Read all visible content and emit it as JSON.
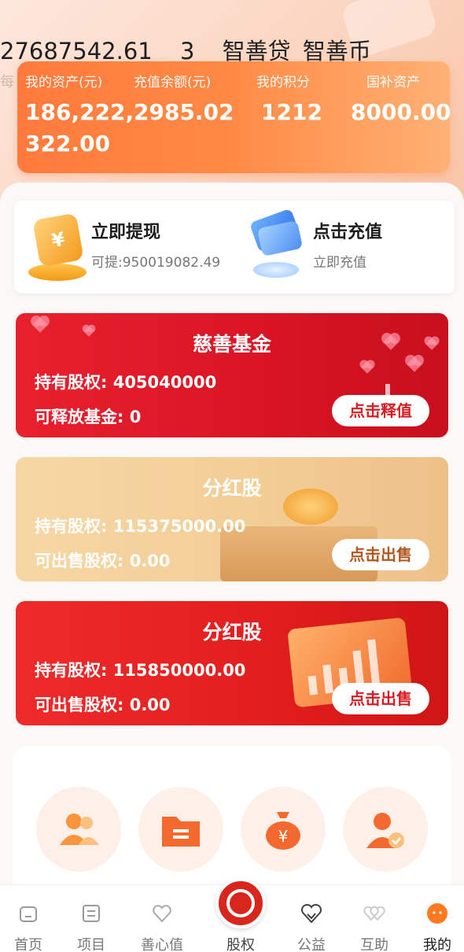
{
  "ticker": {
    "values": [
      "27687542.61",
      "3",
      "智善贷",
      "智善币"
    ],
    "faded_prefix": "每"
  },
  "assets": [
    {
      "label": "我的资产(元)",
      "value": "186,222,\n322.00"
    },
    {
      "label": "充值余额(元)",
      "value": "2985.02"
    },
    {
      "label": "我的积分",
      "value": "1212"
    },
    {
      "label": "国补资产",
      "value": "8000.00"
    }
  ],
  "quick_actions": {
    "withdraw": {
      "title": "立即提现",
      "sub": "可提:950019082.49"
    },
    "recharge": {
      "title": "点击充值",
      "sub": "立即充值"
    }
  },
  "banners": [
    {
      "title": "慈善基金",
      "line1": "持有股权: 405040000",
      "line2": "可释放基金: 0",
      "button": "点击释值"
    },
    {
      "title": "分红股",
      "line1": "持有股权: 115375000.00",
      "line2": "可出售股权: 0.00",
      "button": "点击出售"
    },
    {
      "title": "分红股",
      "line1": "持有股权: 115850000.00",
      "line2": "可出售股权: 0.00",
      "button": "点击出售"
    }
  ],
  "menu_icons": [
    "team-icon",
    "folder-icon",
    "money-bag-icon",
    "verified-user-icon"
  ],
  "tabs": [
    {
      "label": "首页",
      "icon": "home-icon"
    },
    {
      "label": "项目",
      "icon": "list-icon"
    },
    {
      "label": "善心值",
      "icon": "heart-icon"
    },
    {
      "label": "股权",
      "icon": "charity-logo-icon"
    },
    {
      "label": "公益",
      "icon": "handshake-heart-icon"
    },
    {
      "label": "互助",
      "icon": "double-heart-icon"
    },
    {
      "label": "我的",
      "icon": "profile-icon"
    }
  ],
  "active_tab": "我的",
  "colors": {
    "accent_orange": "#ff7a3c",
    "banner_red": "#e21d1d",
    "banner_gold": "#f3cd96",
    "center_red": "#d9261c"
  }
}
